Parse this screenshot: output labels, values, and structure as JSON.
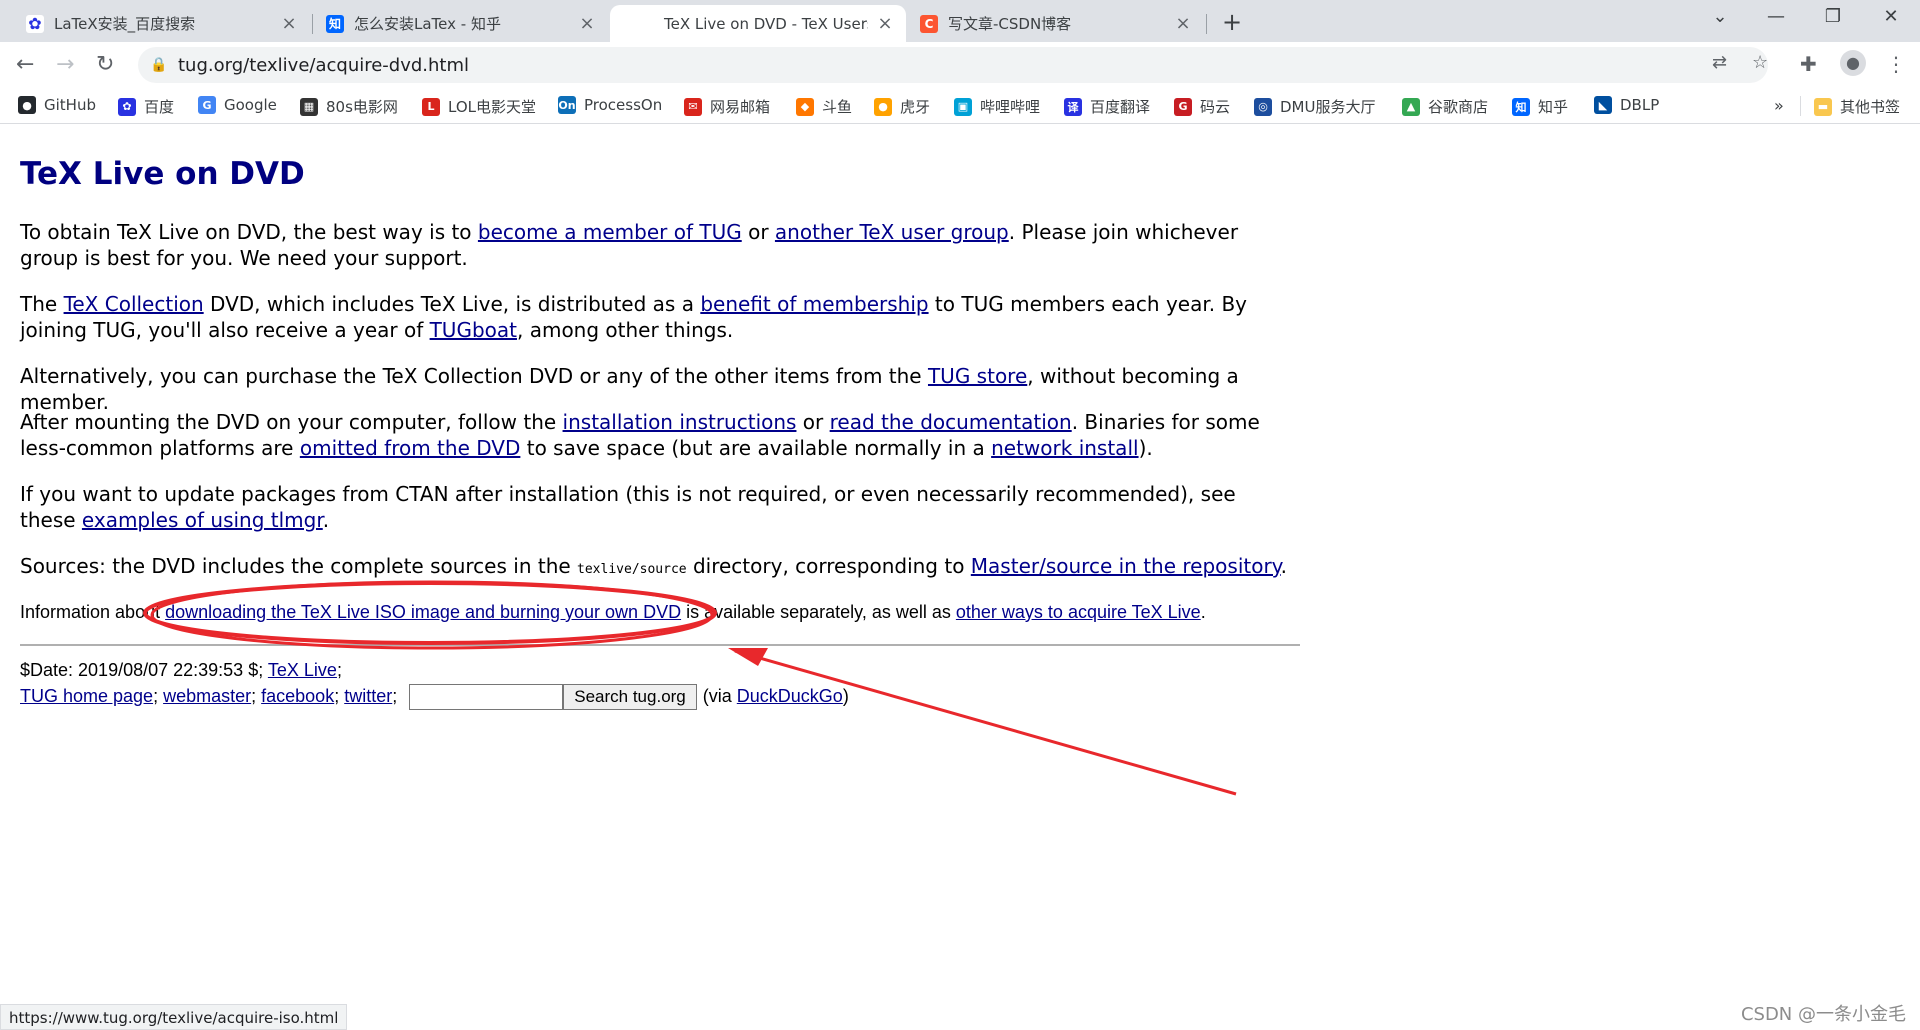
{
  "tabs": [
    {
      "title": "LaTeX安装_百度搜索",
      "icon": "baidu-paw-icon"
    },
    {
      "title": "怎么安装LaTex - 知乎",
      "icon": "zhihu-icon"
    },
    {
      "title": "TeX Live on DVD - TeX Users G",
      "icon": "none"
    },
    {
      "title": "写文章-CSDN博客",
      "icon": "csdn-icon"
    }
  ],
  "address_bar": {
    "url": "tug.org/texlive/acquire-dvd.html"
  },
  "bookmarks": [
    {
      "label": "GitHub",
      "color": "#24292e"
    },
    {
      "label": "百度",
      "color": "#2932e1"
    },
    {
      "label": "Google",
      "color": "#4285f4"
    },
    {
      "label": "80s电影网",
      "color": "#333333"
    },
    {
      "label": "LOL电影天堂",
      "color": "#d9251c"
    },
    {
      "label": "ProcessOn",
      "color": "#0d6fb8"
    },
    {
      "label": "网易邮箱",
      "color": "#d9251c"
    },
    {
      "label": "斗鱼",
      "color": "#ff7700"
    },
    {
      "label": "虎牙",
      "color": "#ffa200"
    },
    {
      "label": "哔哩哔哩",
      "color": "#00a1d6"
    },
    {
      "label": "百度翻译",
      "color": "#2932e1"
    },
    {
      "label": "码云",
      "color": "#c71d23"
    },
    {
      "label": "DMU服务大厅",
      "color": "#1d4e9e"
    },
    {
      "label": "谷歌商店",
      "color": "#34a853"
    },
    {
      "label": "知乎",
      "color": "#0066ff"
    },
    {
      "label": "DBLP",
      "color": "#004f9f"
    }
  ],
  "bookmarks_overflow": "»",
  "other_bookmarks": "其他书签",
  "page": {
    "title": "TeX Live on DVD",
    "p1": {
      "t1": "To obtain TeX Live on DVD, the best way is to ",
      "l1": "become a member of TUG",
      "t2": " or ",
      "l2": "another TeX user group",
      "t3": ". Please join whichever group is best for you. We need your support."
    },
    "p2": {
      "t1": "The ",
      "l1": "TeX Collection",
      "t2": " DVD, which includes TeX Live, is distributed as a ",
      "l2": "benefit of membership",
      "t3": " to TUG members each year. By joining TUG, you'll also receive a year of ",
      "l3": "TUGboat",
      "t4": ", among other things."
    },
    "p3": {
      "t1": "Alternatively, you can purchase the TeX Collection DVD or any of the other items from the ",
      "l1": "TUG store",
      "t2": ", without becoming a member."
    },
    "p4": {
      "t1": "After mounting the DVD on your computer, follow the ",
      "l1": "installation instructions",
      "t2": " or ",
      "l2": "read the documentation",
      "t3": ". Binaries for some less-common platforms are ",
      "l3": "omitted from the DVD",
      "t4": " to save space (but are available normally in a ",
      "l4": "network install",
      "t5": ")."
    },
    "p5": {
      "t1": "If you want to update packages from CTAN after installation (this is not required, or even necessarily recommended), see these ",
      "l1": "examples of using tlmgr",
      "t2": "."
    },
    "p6": {
      "t1": "Sources: the DVD includes the complete sources in the ",
      "code": "texlive/source",
      "t2": " directory, corresponding to ",
      "l1": "Master/source in the repository",
      "t3": "."
    },
    "p7": {
      "t1": "Information about ",
      "l1": "downloading the TeX Live ISO image and burning your own DVD",
      "t2": " is available separately, as well as ",
      "l2": "other ways to acquire TeX Live",
      "t3": "."
    },
    "footer": {
      "date": "$Date: 2019/08/07 22:39:53 $; ",
      "texlive": "TeX Live",
      "semi": ";",
      "home": "TUG home page",
      "webmaster": "webmaster",
      "facebook": "facebook",
      "twitter": "twitter",
      "sep": "; ",
      "search_button": "Search tug.org",
      "via_pre": "(via ",
      "duckduckgo": "DuckDuckGo",
      "via_post": ")"
    }
  },
  "status_bar": "https://www.tug.org/texlive/acquire-iso.html",
  "watermark": "CSDN @一条小金毛",
  "annotation": {
    "color": "#e8282c"
  }
}
